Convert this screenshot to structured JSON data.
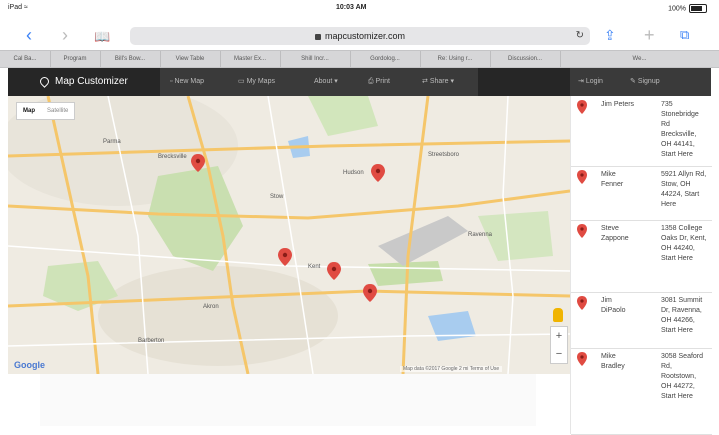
{
  "status_bar": {
    "carrier": "iPad ≈",
    "time": "10:03 AM",
    "battery": "100%"
  },
  "browser": {
    "url": "mapcustomizer.com"
  },
  "tabs": [
    "Cal Ba...",
    "Program",
    "Bill's Bow...",
    "View Table",
    "Master Ex...",
    "Shill Incr...",
    "Gordolog...",
    "Re: Using r...",
    "Discussion...",
    "We..."
  ],
  "app": {
    "brand": "Map Customizer",
    "menu": [
      "New Map",
      "My Maps",
      "About",
      "Print",
      "Share"
    ],
    "right_menu": [
      "Login",
      "Signup"
    ]
  },
  "map": {
    "type_options": [
      "Map",
      "Satellite"
    ],
    "selected_type": "Map",
    "attribution": "Map data ©2017 Google   2 mi   Terms of Use",
    "provider": "Google",
    "labels": [
      "Parma",
      "Brecksville",
      "Stow",
      "Kent",
      "Akron",
      "Hudson",
      "Streetsboro",
      "Ravenna",
      "Barberton"
    ],
    "marker_color": "#e04b42"
  },
  "locations": [
    {
      "name": "Jim Peters",
      "address": "735 Stonebridge Rd Brecksville, OH 44141, Start Here"
    },
    {
      "name": "Mike Fenner",
      "address": "5921 Allyn Rd, Stow, OH 44224, Start Here"
    },
    {
      "name": "Steve Zappone",
      "address": "1358 College Oaks Dr, Kent, OH 44240, Start Here"
    },
    {
      "name": "Jim DiPaolo",
      "address": "3081 Summit Dr, Ravenna, OH 44266, Start Here"
    },
    {
      "name": "Mike Bradley",
      "address": "3058 Seaford Rd, Rootstown, OH 44272, Start Here"
    }
  ]
}
